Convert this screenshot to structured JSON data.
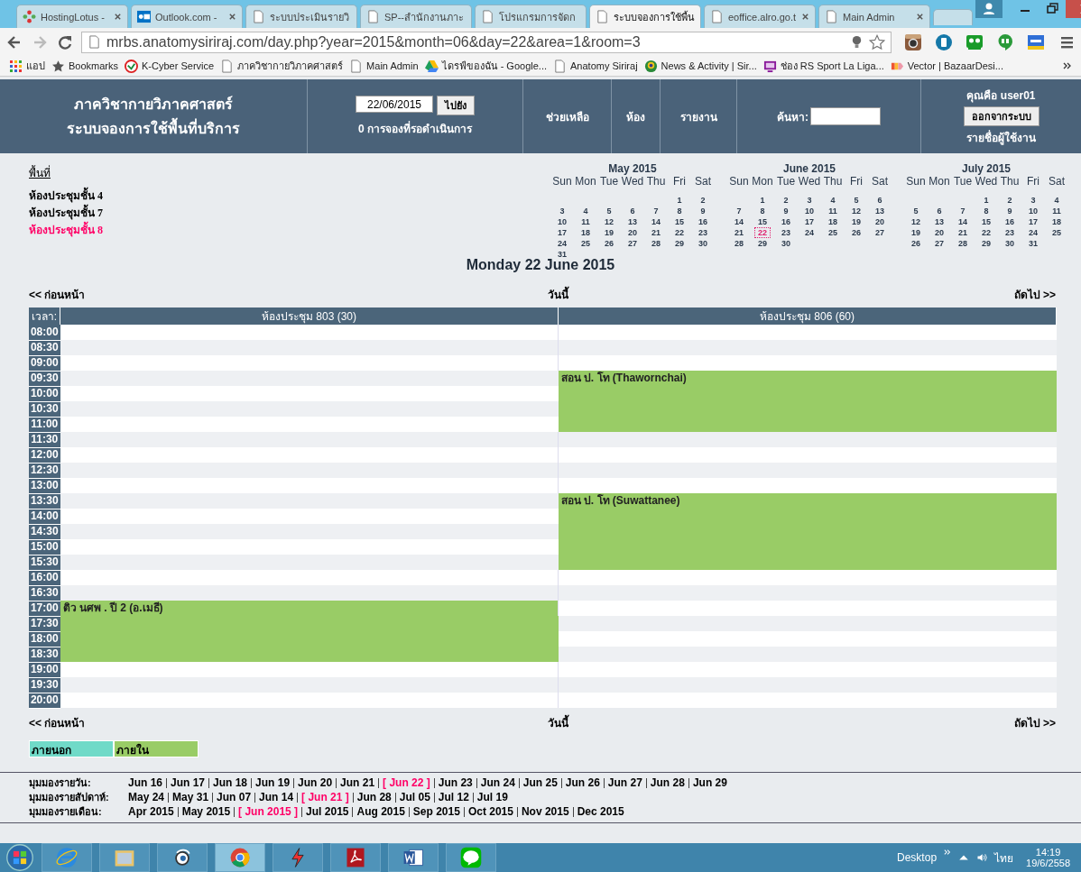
{
  "browser": {
    "tabs": [
      {
        "title": "HostingLotus -",
        "kind": "hosting",
        "selected": false
      },
      {
        "title": "Outlook.com -",
        "kind": "outlook",
        "selected": false
      },
      {
        "title": "ระบบประเมินรายวิ",
        "kind": "page",
        "selected": false
      },
      {
        "title": "SP--สำนักงานภาะ",
        "kind": "page",
        "selected": false
      },
      {
        "title": "โปรแกรมการจัดก",
        "kind": "page",
        "selected": false
      },
      {
        "title": "ระบบจองการใช้พื้น",
        "kind": "page",
        "selected": true
      },
      {
        "title": "eoffice.alro.go.t",
        "kind": "page",
        "selected": false
      },
      {
        "title": "Main Admin",
        "kind": "page",
        "selected": false
      }
    ],
    "address": "mrbs.anatomysiriraj.com/day.php?year=2015&month=06&day=22&area=1&room=3",
    "bookmarks": [
      {
        "label": "แอป",
        "kind": "apps"
      },
      {
        "label": "Bookmarks",
        "kind": "star"
      },
      {
        "label": "K-Cyber Service",
        "kind": "kcyber"
      },
      {
        "label": "ภาควิชากายวิภาคศาสตร์",
        "kind": "page"
      },
      {
        "label": "Main Admin",
        "kind": "page"
      },
      {
        "label": "ไดรฟ์ของฉัน - Google...",
        "kind": "drive"
      },
      {
        "label": "Anatomy Siriraj",
        "kind": "page"
      },
      {
        "label": "News & Activity | Sir...",
        "kind": "emblem"
      },
      {
        "label": "ช่อง RS Sport La Liga...",
        "kind": "tv"
      },
      {
        "label": "Vector | BazaarDesi...",
        "kind": "vector"
      }
    ]
  },
  "header": {
    "title_lines": [
      "ภาควิชากายวิภาคศาสตร์",
      "ระบบจองการใช้พื้นที่บริการ"
    ],
    "date_value": "22/06/2015",
    "go_button": "ไปยัง",
    "pending": "0 การจองที่รอดำเนินการ",
    "menu": [
      "ช่วยเหลือ",
      "ห้อง",
      "รายงาน"
    ],
    "search_label": "ค้นหา:",
    "user": "คุณคือ user01",
    "logout_button": "ออกจากระบบ",
    "users_link": "รายชื่อผู้ใช้งาน"
  },
  "areas": {
    "heading": "พื้นที่",
    "items": [
      {
        "label": "ห้องประชุมชั้น 4",
        "selected": false
      },
      {
        "label": "ห้องประชุมชั้น 7",
        "selected": false
      },
      {
        "label": "ห้องประชุมชั้น 8",
        "selected": true
      }
    ]
  },
  "calendars": [
    {
      "title": "May 2015",
      "weekdays": [
        "Sun",
        "Mon",
        "Tue",
        "Wed",
        "Thu",
        "Fri",
        "Sat"
      ],
      "weeks": [
        [
          {
            "day": "1",
            "selected": false
          },
          {
            "day": "2",
            "selected": false
          }
        ],
        [
          {
            "day": "3",
            "selected": false
          },
          {
            "day": "4",
            "selected": false
          },
          {
            "day": "5",
            "selected": false
          },
          {
            "day": "6",
            "selected": false
          },
          {
            "day": "7",
            "selected": false
          },
          {
            "day": "8",
            "selected": false
          },
          {
            "day": "9",
            "selected": false
          }
        ],
        [
          {
            "day": "10",
            "selected": false
          },
          {
            "day": "11",
            "selected": false
          },
          {
            "day": "12",
            "selected": false
          },
          {
            "day": "13",
            "selected": false
          },
          {
            "day": "14",
            "selected": false
          },
          {
            "day": "15",
            "selected": false
          },
          {
            "day": "16",
            "selected": false
          }
        ],
        [
          {
            "day": "17",
            "selected": false
          },
          {
            "day": "18",
            "selected": false
          },
          {
            "day": "19",
            "selected": false
          },
          {
            "day": "20",
            "selected": false
          },
          {
            "day": "21",
            "selected": false
          },
          {
            "day": "22",
            "selected": false
          },
          {
            "day": "23",
            "selected": false
          }
        ],
        [
          {
            "day": "24",
            "selected": false
          },
          {
            "day": "25",
            "selected": false
          },
          {
            "day": "26",
            "selected": false
          },
          {
            "day": "27",
            "selected": false
          },
          {
            "day": "28",
            "selected": false
          },
          {
            "day": "29",
            "selected": false
          },
          {
            "day": "30",
            "selected": false
          }
        ],
        [
          {
            "day": "31",
            "selected": false
          }
        ]
      ]
    },
    {
      "title": "June 2015",
      "weekdays": [
        "Sun",
        "Mon",
        "Tue",
        "Wed",
        "Thu",
        "Fri",
        "Sat"
      ],
      "weeks": [
        [
          {
            "day": "1",
            "selected": false
          },
          {
            "day": "2",
            "selected": false
          },
          {
            "day": "3",
            "selected": false
          },
          {
            "day": "4",
            "selected": false
          },
          {
            "day": "5",
            "selected": false
          },
          {
            "day": "6",
            "selected": false
          }
        ],
        [
          {
            "day": "7",
            "selected": false
          },
          {
            "day": "8",
            "selected": false
          },
          {
            "day": "9",
            "selected": false
          },
          {
            "day": "10",
            "selected": false
          },
          {
            "day": "11",
            "selected": false
          },
          {
            "day": "12",
            "selected": false
          },
          {
            "day": "13",
            "selected": false
          }
        ],
        [
          {
            "day": "14",
            "selected": false
          },
          {
            "day": "15",
            "selected": false
          },
          {
            "day": "16",
            "selected": false
          },
          {
            "day": "17",
            "selected": false
          },
          {
            "day": "18",
            "selected": false
          },
          {
            "day": "19",
            "selected": false
          },
          {
            "day": "20",
            "selected": false
          }
        ],
        [
          {
            "day": "21",
            "selected": false
          },
          {
            "day": "22",
            "selected": true
          },
          {
            "day": "23",
            "selected": false
          },
          {
            "day": "24",
            "selected": false
          },
          {
            "day": "25",
            "selected": false
          },
          {
            "day": "26",
            "selected": false
          },
          {
            "day": "27",
            "selected": false
          }
        ],
        [
          {
            "day": "28",
            "selected": false
          },
          {
            "day": "29",
            "selected": false
          },
          {
            "day": "30",
            "selected": false
          }
        ]
      ]
    },
    {
      "title": "July 2015",
      "weekdays": [
        "Sun",
        "Mon",
        "Tue",
        "Wed",
        "Thu",
        "Fri",
        "Sat"
      ],
      "weeks": [
        [
          {
            "day": "1",
            "selected": false
          },
          {
            "day": "2",
            "selected": false
          },
          {
            "day": "3",
            "selected": false
          },
          {
            "day": "4",
            "selected": false
          }
        ],
        [
          {
            "day": "5",
            "selected": false
          },
          {
            "day": "6",
            "selected": false
          },
          {
            "day": "7",
            "selected": false
          },
          {
            "day": "8",
            "selected": false
          },
          {
            "day": "9",
            "selected": false
          },
          {
            "day": "10",
            "selected": false
          },
          {
            "day": "11",
            "selected": false
          }
        ],
        [
          {
            "day": "12",
            "selected": false
          },
          {
            "day": "13",
            "selected": false
          },
          {
            "day": "14",
            "selected": false
          },
          {
            "day": "15",
            "selected": false
          },
          {
            "day": "16",
            "selected": false
          },
          {
            "day": "17",
            "selected": false
          },
          {
            "day": "18",
            "selected": false
          }
        ],
        [
          {
            "day": "19",
            "selected": false
          },
          {
            "day": "20",
            "selected": false
          },
          {
            "day": "21",
            "selected": false
          },
          {
            "day": "22",
            "selected": false
          },
          {
            "day": "23",
            "selected": false
          },
          {
            "day": "24",
            "selected": false
          },
          {
            "day": "25",
            "selected": false
          }
        ],
        [
          {
            "day": "26",
            "selected": false
          },
          {
            "day": "27",
            "selected": false
          },
          {
            "day": "28",
            "selected": false
          },
          {
            "day": "29",
            "selected": false
          },
          {
            "day": "30",
            "selected": false
          },
          {
            "day": "31",
            "selected": false
          }
        ]
      ]
    }
  ],
  "day_title": "Monday 22 June 2015",
  "nav_top": {
    "prev": "<< ก่อนหน้า",
    "today": "วันนี้",
    "next": "ถัดไป >>"
  },
  "grid": {
    "time_heading": "เวลา:",
    "rooms": [
      "ห้องประชุม 803 (30)",
      "ห้องประชุม 806 (60)"
    ],
    "rows": [
      {
        "time": "08:00",
        "cells": [
          {
            "kind": "free"
          },
          {
            "kind": "free"
          }
        ]
      },
      {
        "time": "08:30",
        "cells": [
          {
            "kind": "free"
          },
          {
            "kind": "free"
          }
        ]
      },
      {
        "time": "09:00",
        "cells": [
          {
            "kind": "free"
          },
          {
            "kind": "free"
          }
        ]
      },
      {
        "time": "09:30",
        "cells": [
          {
            "kind": "free"
          },
          {
            "kind": "booking",
            "label": "สอน ป. โท (Thawornchai)",
            "color": "#99cc66"
          }
        ]
      },
      {
        "time": "10:00",
        "cells": [
          {
            "kind": "free"
          },
          {
            "kind": "covered"
          }
        ]
      },
      {
        "time": "10:30",
        "cells": [
          {
            "kind": "free"
          },
          {
            "kind": "covered"
          }
        ]
      },
      {
        "time": "11:00",
        "cells": [
          {
            "kind": "free"
          },
          {
            "kind": "covered"
          }
        ]
      },
      {
        "time": "11:30",
        "cells": [
          {
            "kind": "free"
          },
          {
            "kind": "free"
          }
        ]
      },
      {
        "time": "12:00",
        "cells": [
          {
            "kind": "free"
          },
          {
            "kind": "free"
          }
        ]
      },
      {
        "time": "12:30",
        "cells": [
          {
            "kind": "free"
          },
          {
            "kind": "free"
          }
        ]
      },
      {
        "time": "13:00",
        "cells": [
          {
            "kind": "free"
          },
          {
            "kind": "free"
          }
        ]
      },
      {
        "time": "13:30",
        "cells": [
          {
            "kind": "free"
          },
          {
            "kind": "booking",
            "label": "สอน ป. โท (Suwattanee)",
            "color": "#99cc66"
          }
        ]
      },
      {
        "time": "14:00",
        "cells": [
          {
            "kind": "free"
          },
          {
            "kind": "covered"
          }
        ]
      },
      {
        "time": "14:30",
        "cells": [
          {
            "kind": "free"
          },
          {
            "kind": "covered"
          }
        ]
      },
      {
        "time": "15:00",
        "cells": [
          {
            "kind": "free"
          },
          {
            "kind": "covered"
          }
        ]
      },
      {
        "time": "15:30",
        "cells": [
          {
            "kind": "free"
          },
          {
            "kind": "covered"
          }
        ]
      },
      {
        "time": "16:00",
        "cells": [
          {
            "kind": "free"
          },
          {
            "kind": "free"
          }
        ]
      },
      {
        "time": "16:30",
        "cells": [
          {
            "kind": "free"
          },
          {
            "kind": "free"
          }
        ]
      },
      {
        "time": "17:00",
        "cells": [
          {
            "kind": "booking",
            "label": "ติว นศพ . ปี 2 (อ.เมธี)",
            "color": "#99cc66"
          },
          {
            "kind": "free"
          }
        ]
      },
      {
        "time": "17:30",
        "cells": [
          {
            "kind": "covered"
          },
          {
            "kind": "free"
          }
        ]
      },
      {
        "time": "18:00",
        "cells": [
          {
            "kind": "covered"
          },
          {
            "kind": "free"
          }
        ]
      },
      {
        "time": "18:30",
        "cells": [
          {
            "kind": "covered"
          },
          {
            "kind": "free"
          }
        ]
      },
      {
        "time": "19:00",
        "cells": [
          {
            "kind": "free"
          },
          {
            "kind": "free"
          }
        ]
      },
      {
        "time": "19:30",
        "cells": [
          {
            "kind": "free"
          },
          {
            "kind": "free"
          }
        ]
      },
      {
        "time": "20:00",
        "cells": [
          {
            "kind": "free"
          },
          {
            "kind": "free"
          }
        ]
      }
    ]
  },
  "nav_bottom": {
    "prev": "<< ก่อนหน้า",
    "today": "วันนี้",
    "next": "ถัดไป >>"
  },
  "legend": [
    {
      "label": "ภายนอก",
      "color": "#70dac8"
    },
    {
      "label": "ภายใน",
      "color": "#99cc66"
    }
  ],
  "views": [
    {
      "label": "มุมมองรายวัน:",
      "items": [
        {
          "label": "Jun 16",
          "selected": false
        },
        {
          "label": "Jun 17",
          "selected": false
        },
        {
          "label": "Jun 18",
          "selected": false
        },
        {
          "label": "Jun 19",
          "selected": false
        },
        {
          "label": "Jun 20",
          "selected": false
        },
        {
          "label": "Jun 21",
          "selected": false
        },
        {
          "label": "[ Jun 22 ]",
          "selected": true
        },
        {
          "label": "Jun 23",
          "selected": false
        },
        {
          "label": "Jun 24",
          "selected": false
        },
        {
          "label": "Jun 25",
          "selected": false
        },
        {
          "label": "Jun 26",
          "selected": false
        },
        {
          "label": "Jun 27",
          "selected": false
        },
        {
          "label": "Jun 28",
          "selected": false
        },
        {
          "label": "Jun 29",
          "selected": false
        }
      ]
    },
    {
      "label": "มุมมองรายสัปดาห์:",
      "items": [
        {
          "label": "May 24",
          "selected": false
        },
        {
          "label": "May 31",
          "selected": false
        },
        {
          "label": "Jun 07",
          "selected": false
        },
        {
          "label": "Jun 14",
          "selected": false
        },
        {
          "label": "[ Jun 21 ]",
          "selected": true
        },
        {
          "label": "Jun 28",
          "selected": false
        },
        {
          "label": "Jul 05",
          "selected": false
        },
        {
          "label": "Jul 12",
          "selected": false
        },
        {
          "label": "Jul 19",
          "selected": false
        }
      ]
    },
    {
      "label": "มุมมองรายเดือน:",
      "items": [
        {
          "label": "Apr 2015",
          "selected": false
        },
        {
          "label": "May 2015",
          "selected": false
        },
        {
          "label": "[ Jun 2015 ]",
          "selected": true
        },
        {
          "label": "Jul 2015",
          "selected": false
        },
        {
          "label": "Aug 2015",
          "selected": false
        },
        {
          "label": "Sep 2015",
          "selected": false
        },
        {
          "label": "Oct 2015",
          "selected": false
        },
        {
          "label": "Nov 2015",
          "selected": false
        },
        {
          "label": "Dec 2015",
          "selected": false
        }
      ]
    }
  ],
  "taskbar": {
    "apps": [
      {
        "kind": "ie",
        "selected": false
      },
      {
        "kind": "folder",
        "selected": false
      },
      {
        "kind": "bird",
        "selected": false
      },
      {
        "kind": "chrome",
        "selected": true
      },
      {
        "kind": "flash",
        "selected": false
      },
      {
        "kind": "pdf",
        "selected": false
      },
      {
        "kind": "word",
        "selected": false
      },
      {
        "kind": "line",
        "selected": false
      }
    ],
    "desktop": "Desktop",
    "language": "ไทย",
    "time": "14:19",
    "date": "19/6/2558"
  }
}
